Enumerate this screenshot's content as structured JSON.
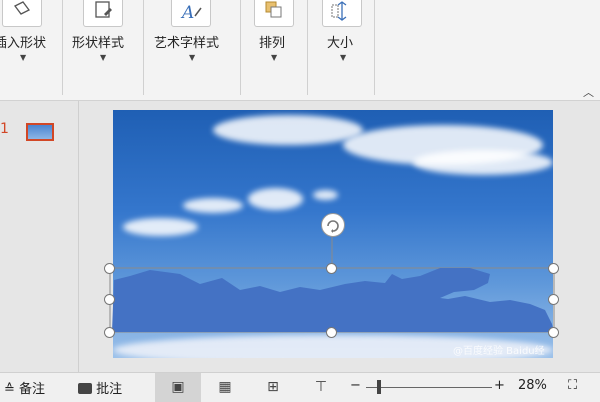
{
  "ribbon": {
    "groups": [
      {
        "label": "插入形状"
      },
      {
        "label": "形状样式"
      },
      {
        "label": "艺术字样式"
      },
      {
        "label": "排列"
      },
      {
        "label": "大小"
      }
    ],
    "collapse_icon": "chevron-up-icon"
  },
  "thumbnails": {
    "slide_number": "1"
  },
  "slide": {
    "watermark": "@百度经验 Baidu经验"
  },
  "statusbar": {
    "notes_label": "备注",
    "comments_label": "批注",
    "zoom_minus": "−",
    "zoom_plus": "+",
    "zoom_value": "28%"
  }
}
